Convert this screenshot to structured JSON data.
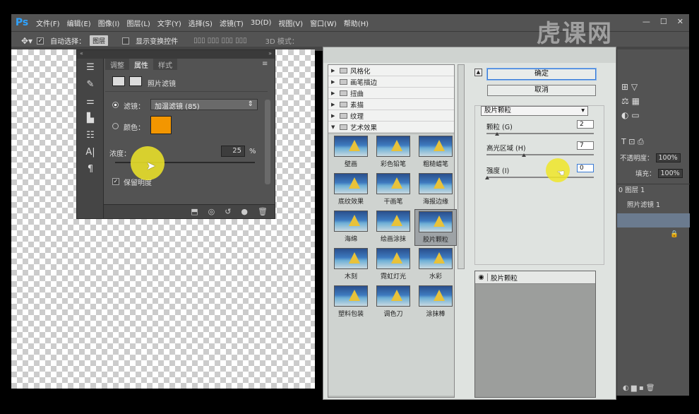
{
  "app": {
    "logo": "Ps"
  },
  "menubar": {
    "items": [
      "文件(F)",
      "编辑(E)",
      "图像(I)",
      "图层(L)",
      "文字(Y)",
      "选择(S)",
      "滤镜(T)",
      "3D(D)",
      "视图(V)",
      "窗口(W)",
      "帮助(H)"
    ]
  },
  "optbar": {
    "move_icon": "move-tool-icon",
    "auto_select_label": "自动选择：",
    "auto_select_value": "图层",
    "transform_label": "显示变换控件",
    "mode_label": "3D 模式："
  },
  "properties": {
    "tabs": [
      "调整",
      "属性",
      "样式"
    ],
    "title": "照片滤镜",
    "filter_label": "滤镜：",
    "filter_value": "加温滤镜 (85)",
    "color_label": "颜色：",
    "color_hex": "#f39600",
    "density_label": "浓度：",
    "density_value": "25",
    "density_unit": "%",
    "preserve_label": "保留明度"
  },
  "gallery": {
    "categories": [
      {
        "label": "风格化",
        "expanded": false
      },
      {
        "label": "画笔描边",
        "expanded": false
      },
      {
        "label": "扭曲",
        "expanded": false
      },
      {
        "label": "素描",
        "expanded": false
      },
      {
        "label": "纹理",
        "expanded": false
      },
      {
        "label": "艺术效果",
        "expanded": true
      }
    ],
    "thumbs": [
      "壁画",
      "彩色铅笔",
      "粗糙蜡笔",
      "底纹效果",
      "干画笔",
      "海报边缘",
      "海绵",
      "绘画涂抹",
      "胶片颗粒",
      "木刻",
      "霓虹灯光",
      "水彩",
      "塑料包装",
      "调色刀",
      "涂抹棒"
    ],
    "selected_thumb": "胶片颗粒",
    "ok_label": "确定",
    "cancel_label": "取消",
    "filter_select": "胶片颗粒",
    "params": [
      {
        "label": "颗粒 (G)",
        "value": "2"
      },
      {
        "label": "高光区域 (H)",
        "value": "7"
      },
      {
        "label": "强度 (I)",
        "value": "0"
      }
    ],
    "layer_name": "胶片颗粒"
  },
  "rpanel": {
    "opacity_label": "不透明度：",
    "opacity_value": "100%",
    "fill_label": "填充：",
    "fill_value": "100%",
    "layer_a": "0 图层 1",
    "layer_b": "照片滤镜 1"
  },
  "watermark": "虎课网"
}
